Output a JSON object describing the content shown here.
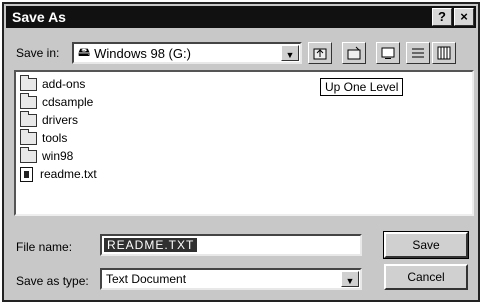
{
  "window": {
    "title": "Save As"
  },
  "titlebar": {
    "help": "?",
    "close": "×"
  },
  "save_in": {
    "label": "Save in:",
    "value": "Windows 98 (G:)"
  },
  "toolbar": {
    "tooltip": "Up One Level"
  },
  "files": [
    {
      "name": "add-ons",
      "icon": "folder-icon"
    },
    {
      "name": "cdsample",
      "icon": "folder-icon"
    },
    {
      "name": "drivers",
      "icon": "folder-icon"
    },
    {
      "name": "tools",
      "icon": "folder-icon"
    },
    {
      "name": "win98",
      "icon": "folder-icon"
    },
    {
      "name": "readme.txt",
      "icon": "text-file-icon"
    }
  ],
  "file_name": {
    "label": "File name:",
    "value": "README.TXT"
  },
  "save_as_type": {
    "label": "Save as type:",
    "value": "Text Document"
  },
  "buttons": {
    "save": "Save",
    "cancel": "Cancel"
  }
}
